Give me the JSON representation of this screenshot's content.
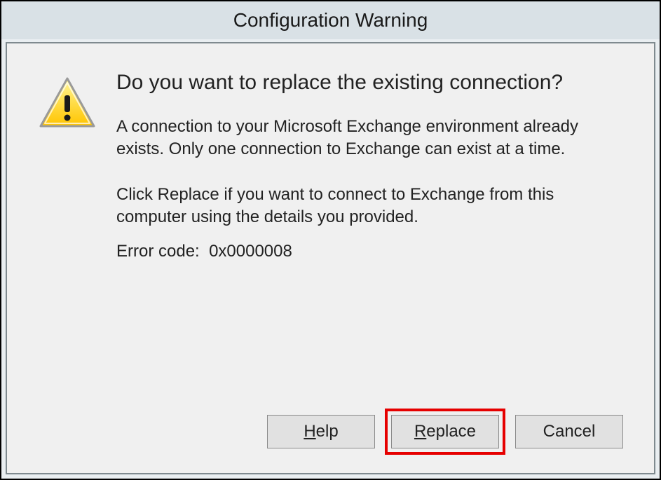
{
  "title": "Configuration Warning",
  "main_instruction": "Do you want to replace the existing connection?",
  "body_paragraph_1": "A connection to your Microsoft Exchange environment already exists. Only one connection to Exchange can exist at a time.",
  "body_paragraph_2": "Click Replace if you want to connect to Exchange from this computer using the details you provided.",
  "error_label": "Error code:",
  "error_code": "0x0000008",
  "buttons": {
    "help_prefix": "H",
    "help_rest": "elp",
    "replace_prefix": "R",
    "replace_rest": "eplace",
    "cancel": "Cancel"
  },
  "icon_name": "warning-icon"
}
